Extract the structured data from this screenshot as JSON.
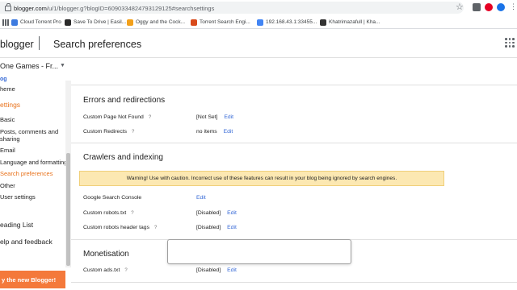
{
  "browser": {
    "url_host": "blogger.com",
    "url_path": "/u/1/blogger.g?blogID=6090334824793129125#searchsettings",
    "bookmarks": [
      {
        "label": "Cloud Torrent Pro",
        "color": "#3d7be0"
      },
      {
        "label": "Save To Drive | Easil...",
        "color": "#2a2a2a"
      },
      {
        "label": "Oggy and the Cock...",
        "color": "#f2a01b"
      },
      {
        "label": "Torrent Search Engi...",
        "color": "#d84a1b"
      },
      {
        "label": "192.168.43.1:33455...",
        "color": "#4285f4"
      },
      {
        "label": "Khatrimazafull | Kha...",
        "color": "#333333"
      }
    ]
  },
  "header": {
    "logo": "blogger",
    "title": "Search preferences"
  },
  "blog_selector": "One Games - Fr...",
  "sidebar": {
    "items": [
      {
        "label": "og",
        "color": "#3367d6",
        "style": "bold"
      },
      {
        "label": "heme"
      },
      {
        "label": "ettings",
        "color": "#e8711a",
        "style": "big"
      },
      {
        "label": "Basic"
      },
      {
        "label": "Posts, comments and"
      },
      {
        "label": "sharing"
      },
      {
        "label": "Email"
      },
      {
        "label": "Language and formatting"
      },
      {
        "label": "Search preferences",
        "color": "#e8711a"
      },
      {
        "label": "Other"
      },
      {
        "label": "User settings"
      },
      {
        "label": "eading List",
        "style": "big"
      },
      {
        "label": "elp and feedback",
        "style": "big"
      }
    ],
    "try_button": "y the new Blogger!"
  },
  "main": {
    "errors": {
      "title": "Errors and redirections",
      "rows": [
        {
          "label": "Custom Page Not Found",
          "help": "?",
          "value": "[Not Set]",
          "edit": "Edit"
        },
        {
          "label": "Custom Redirects",
          "help": "?",
          "value": "no items",
          "edit": "Edit"
        }
      ]
    },
    "crawlers": {
      "title": "Crawlers and indexing",
      "warning": "Warning! Use with caution. Incorrect use of these features can result in your blog being ignored by search engines.",
      "rows": [
        {
          "label": "Google Search Console",
          "help": "",
          "value": "",
          "edit": "Edit"
        },
        {
          "label": "Custom robots.txt",
          "help": "?",
          "value": "[Disabled]",
          "edit": "Edit"
        },
        {
          "label": "Custom robots header tags",
          "help": "?",
          "value": "[Disabled]",
          "edit": "Edit"
        }
      ]
    },
    "monetisation": {
      "title": "Monetisation",
      "rows": [
        {
          "label": "Custom ads.txt",
          "help": "?",
          "value": "[Disabled]",
          "edit": "Edit"
        }
      ]
    }
  },
  "colors": {
    "accent_orange": "#e8711a",
    "link_blue": "#3367d6",
    "warning_bg": "#fce8b2"
  }
}
